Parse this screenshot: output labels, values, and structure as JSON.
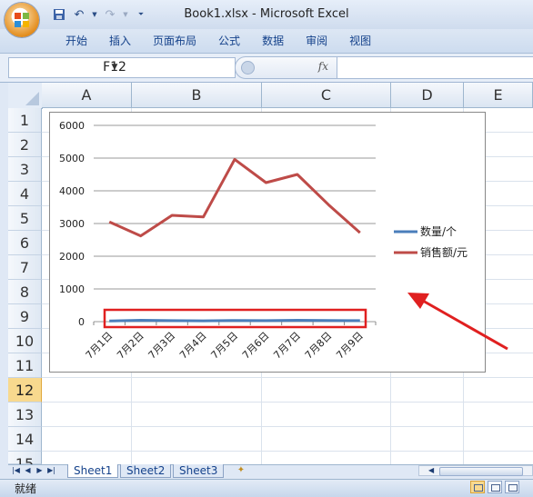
{
  "window": {
    "title": "Book1.xlsx - Microsoft Excel"
  },
  "qat": {
    "icons": [
      "save-icon",
      "undo-icon",
      "redo-icon",
      "customize-icon"
    ]
  },
  "ribbon": {
    "tabs": [
      "开始",
      "插入",
      "页面布局",
      "公式",
      "数据",
      "审阅",
      "视图"
    ]
  },
  "formula_bar": {
    "name_box": "F12",
    "fx_label": "fx",
    "formula": ""
  },
  "grid": {
    "columns": [
      "A",
      "B",
      "C",
      "D",
      "E"
    ],
    "rows": [
      "1",
      "2",
      "3",
      "4",
      "5",
      "6",
      "7",
      "8",
      "9",
      "10",
      "11",
      "12",
      "13",
      "14",
      "15"
    ],
    "selected_row": "12"
  },
  "chart_data": {
    "type": "line",
    "categories": [
      "7月1日",
      "7月2日",
      "7月3日",
      "7月4日",
      "7月5日",
      "7月6日",
      "7月7日",
      "7月8日",
      "7月9日"
    ],
    "series": [
      {
        "name": "数量/个",
        "color": "#4a7ebb",
        "values": [
          20,
          40,
          30,
          25,
          35,
          30,
          40,
          35,
          30
        ]
      },
      {
        "name": "销售额/元",
        "color": "#be4b48",
        "values": [
          3050,
          2620,
          3250,
          3200,
          4960,
          4250,
          4500,
          3570,
          2720
        ]
      }
    ],
    "yticks": [
      0,
      1000,
      2000,
      3000,
      4000,
      5000,
      6000
    ],
    "ylim": [
      0,
      6000
    ],
    "grid": true,
    "legend_position": "right"
  },
  "annotation": {
    "highlight_color": "#e02020",
    "arrow_color": "#e02020"
  },
  "sheets": {
    "tabs": [
      "Sheet1",
      "Sheet2",
      "Sheet3"
    ],
    "active": "Sheet1"
  },
  "status": {
    "text": "就绪"
  }
}
